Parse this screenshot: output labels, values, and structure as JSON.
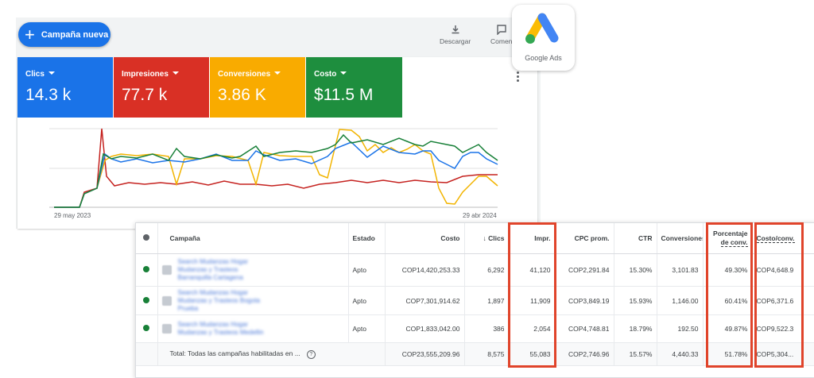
{
  "toolbar": {
    "new_campaign_label": "Campaña nueva",
    "download_label": "Descargar",
    "comments_label": "Comen"
  },
  "logo": {
    "label": "Google Ads"
  },
  "metrics": [
    {
      "label": "Clics",
      "value": "14.3 k",
      "color": "#1a73e8"
    },
    {
      "label": "Impresiones",
      "value": "77.7 k",
      "color": "#d93025"
    },
    {
      "label": "Conversiones",
      "value": "3.86 K",
      "color": "#f9ab00"
    },
    {
      "label": "Costo",
      "value": "$11.5 M",
      "color": "#1e8e3e"
    }
  ],
  "chart": {
    "start_date": "29 may 2023",
    "end_date": "29 abr 2024"
  },
  "table": {
    "headers": {
      "campaign": "Campaña",
      "status": "Estado",
      "cost": "Costo",
      "clicks": "Clics",
      "impr": "Impr.",
      "cpc": "CPC prom.",
      "ctr": "CTR",
      "conversions": "Conversiones",
      "conv_rate_1": "Porcentaje",
      "conv_rate_2": "de conv.",
      "cost_conv": "Costo/conv."
    },
    "rows": [
      {
        "status": "Apto",
        "cost": "COP14,420,253.33",
        "clicks": "6,292",
        "impr": "41,120",
        "cpc": "COP2,291.84",
        "ctr": "15.30%",
        "conversions": "3,101.83",
        "conv_rate": "49.30%",
        "cost_conv": "COP4,648.9"
      },
      {
        "status": "Apto",
        "cost": "COP7,301,914.62",
        "clicks": "1,897",
        "impr": "11,909",
        "cpc": "COP3,849.19",
        "ctr": "15.93%",
        "conversions": "1,146.00",
        "conv_rate": "60.41%",
        "cost_conv": "COP6,371.6"
      },
      {
        "status": "Apto",
        "cost": "COP1,833,042.00",
        "clicks": "386",
        "impr": "2,054",
        "cpc": "COP4,748.81",
        "ctr": "18.79%",
        "conversions": "192.50",
        "conv_rate": "49.87%",
        "cost_conv": "COP9,522.3"
      }
    ],
    "total": {
      "label": "Total: Todas las campañas habilitadas en ...",
      "cost": "COP23,555,209.96",
      "clicks": "8,575",
      "impr": "55,083",
      "cpc": "COP2,746.96",
      "ctr": "15.57%",
      "conversions": "4,440.33",
      "conv_rate": "51.78%",
      "cost_conv": "COP5,304..."
    }
  }
}
